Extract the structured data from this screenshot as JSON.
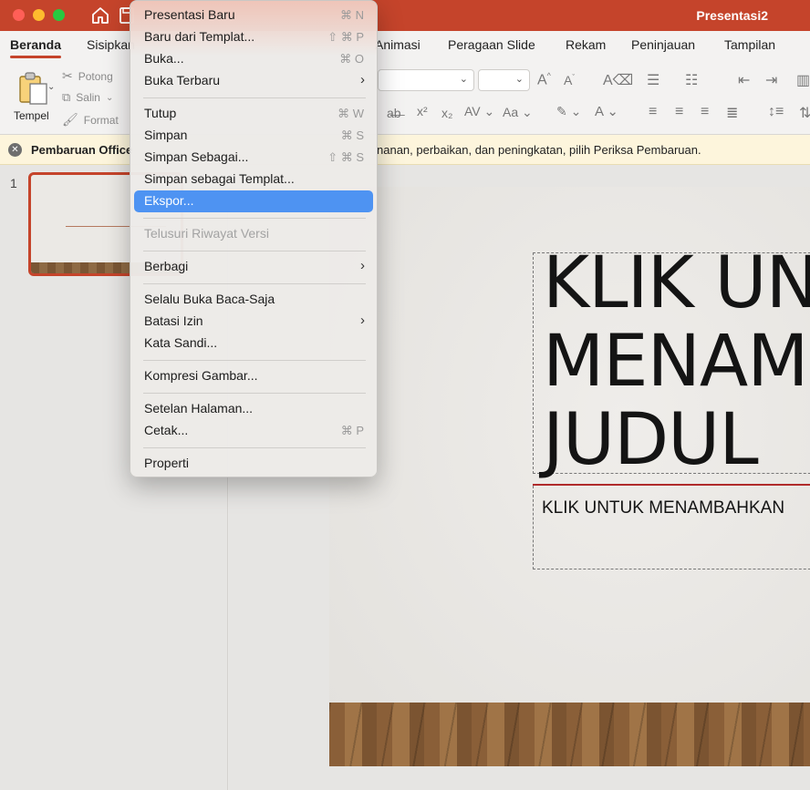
{
  "window": {
    "title": "Presentasi2"
  },
  "ribbon_tabs": [
    "Beranda",
    "Sisipkan",
    "Animasi",
    "Peragaan Slide",
    "Rekam",
    "Peninjauan",
    "Tampilan"
  ],
  "clipboard": {
    "paste": "Tempel",
    "cut": "Potong",
    "copy": "Salin",
    "format": "Format"
  },
  "notification": {
    "title": "Pembaruan Office",
    "message": "nanan, perbaikan, dan peningkatan, pilih Periksa Pembaruan."
  },
  "thumbnails": [
    {
      "number": "1"
    }
  ],
  "slide": {
    "title": "KLIK UN\nMENAME\nJUDUL",
    "subtitle": "KLIK UNTUK MENAMBAHKAN"
  },
  "file_menu": {
    "items": [
      {
        "label": "Presentasi Baru",
        "shortcut": "⌘ N"
      },
      {
        "label": "Baru dari Templat...",
        "shortcut": "⇧ ⌘ P"
      },
      {
        "label": "Buka...",
        "shortcut": "⌘ O"
      },
      {
        "label": "Buka Terbaru",
        "submenu": true
      },
      {
        "label": "Tutup",
        "shortcut": "⌘ W"
      },
      {
        "label": "Simpan",
        "shortcut": "⌘ S"
      },
      {
        "label": "Simpan Sebagai...",
        "shortcut": "⇧ ⌘ S"
      },
      {
        "label": "Simpan sebagai Templat..."
      },
      {
        "label": "Ekspor...",
        "highlighted": true
      },
      {
        "label": "Telusuri Riwayat Versi",
        "disabled": true
      },
      {
        "label": "Berbagi",
        "submenu": true
      },
      {
        "label": "Selalu Buka Baca-Saja"
      },
      {
        "label": "Batasi Izin",
        "submenu": true
      },
      {
        "label": "Kata Sandi..."
      },
      {
        "label": "Kompresi Gambar..."
      },
      {
        "label": "Setelan Halaman..."
      },
      {
        "label": "Cetak...",
        "shortcut": "⌘ P"
      },
      {
        "label": "Properti"
      }
    ]
  },
  "colors": {
    "accent": "#c5442b",
    "highlight": "#4e93f2",
    "notification_bg": "#fdf5dc"
  }
}
